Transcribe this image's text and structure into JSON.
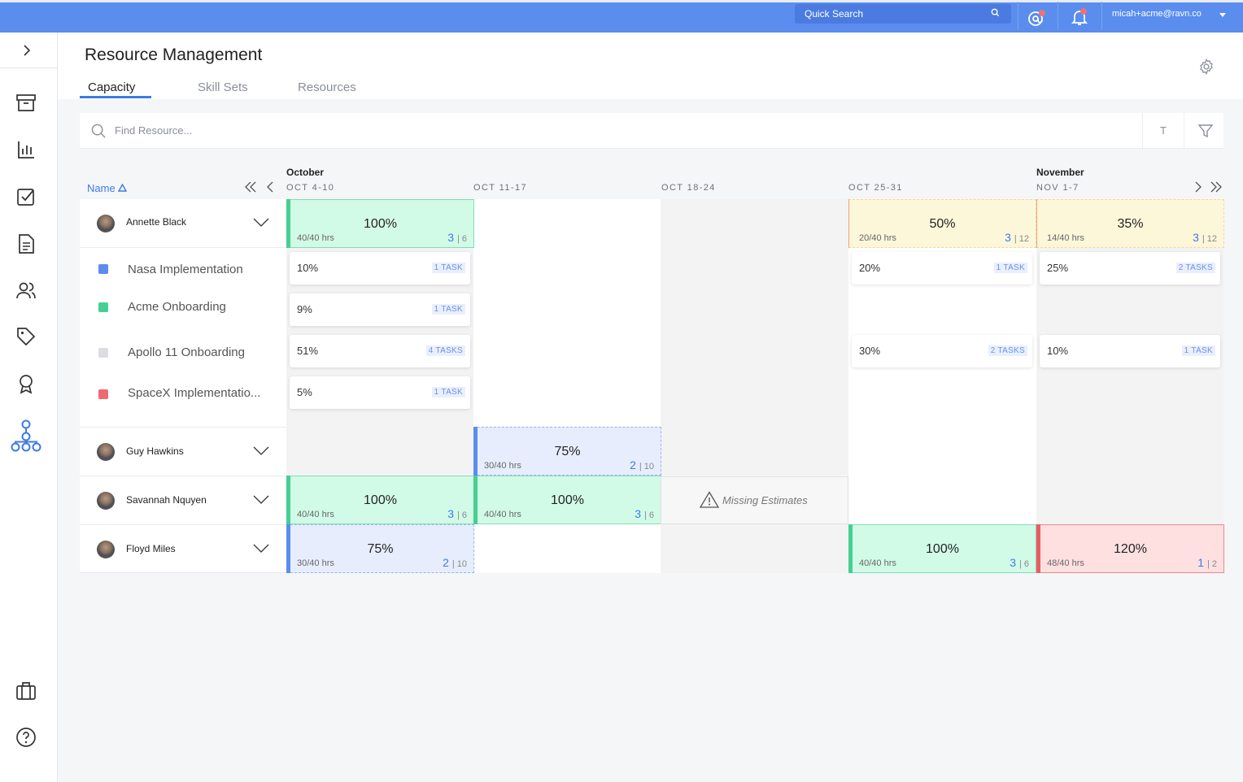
{
  "topbar": {
    "quick_search": "Quick Search",
    "user_email": "micah+acme@ravn.co"
  },
  "page": {
    "title": "Resource Management",
    "tabs": [
      "Capacity",
      "Skill Sets",
      "Resources"
    ],
    "active_tab": "Capacity"
  },
  "search": {
    "placeholder": "Find Resource...",
    "t_button": "T"
  },
  "timeline": {
    "name_header": "Name",
    "months": [
      "October",
      "November"
    ],
    "weeks": [
      "OCT 4-10",
      "OCT 11-17",
      "OCT 18-24",
      "OCT 25-31",
      "NOV 1-7"
    ]
  },
  "resources": [
    {
      "name": "Annette Black"
    },
    {
      "name": "Guy Hawkins"
    },
    {
      "name": "Savannah Nquyen"
    },
    {
      "name": "Floyd Miles"
    }
  ],
  "projects": [
    {
      "name": "Nasa Implementation",
      "color": "#5b8def"
    },
    {
      "name": "Acme Onboarding",
      "color": "#47cf92"
    },
    {
      "name": "Apollo 11 Onboarding",
      "color": "#dcdde0"
    },
    {
      "name": "SpaceX Implementatio...",
      "color": "#ef6a70"
    }
  ],
  "allocations": {
    "annette_w1": {
      "pct": "100%",
      "hrs": "40/40 hrs",
      "a": "3",
      "b": "| 6"
    },
    "annette_w4": {
      "pct": "50%",
      "hrs": "20/40 hrs",
      "a": "3",
      "b": "| 12"
    },
    "annette_w5": {
      "pct": "35%",
      "hrs": "14/40 hrs",
      "a": "3",
      "b": "| 12"
    },
    "guy_w2": {
      "pct": "75%",
      "hrs": "30/40 hrs",
      "a": "2",
      "b": "| 10"
    },
    "savannah_w1": {
      "pct": "100%",
      "hrs": "40/40 hrs",
      "a": "3",
      "b": "| 6"
    },
    "savannah_w2": {
      "pct": "100%",
      "hrs": "40/40 hrs",
      "a": "3",
      "b": "| 6"
    },
    "floyd_w1": {
      "pct": "75%",
      "hrs": "30/40 hrs",
      "a": "2",
      "b": "| 10"
    },
    "floyd_w4": {
      "pct": "100%",
      "hrs": "40/40 hrs",
      "a": "3",
      "b": "| 6"
    },
    "floyd_w5": {
      "pct": "120%",
      "hrs": "48/40 hrs",
      "a": "1",
      "b": "| 2"
    }
  },
  "tasks": {
    "w1": [
      {
        "v": "10%",
        "n": "1 TASK"
      },
      {
        "v": "9%",
        "n": "1 TASK"
      },
      {
        "v": "51%",
        "n": "4 TASKS"
      },
      {
        "v": "5%",
        "n": "1 TASK"
      }
    ],
    "w4": [
      {
        "v": "20%",
        "n": "1 TASK"
      },
      {
        "v": "30%",
        "n": "2 TASKS"
      }
    ],
    "w5": [
      {
        "v": "25%",
        "n": "2 TASKS"
      },
      {
        "v": "10%",
        "n": "1 TASK"
      }
    ]
  },
  "missing_estimates": "Missing Estimates"
}
